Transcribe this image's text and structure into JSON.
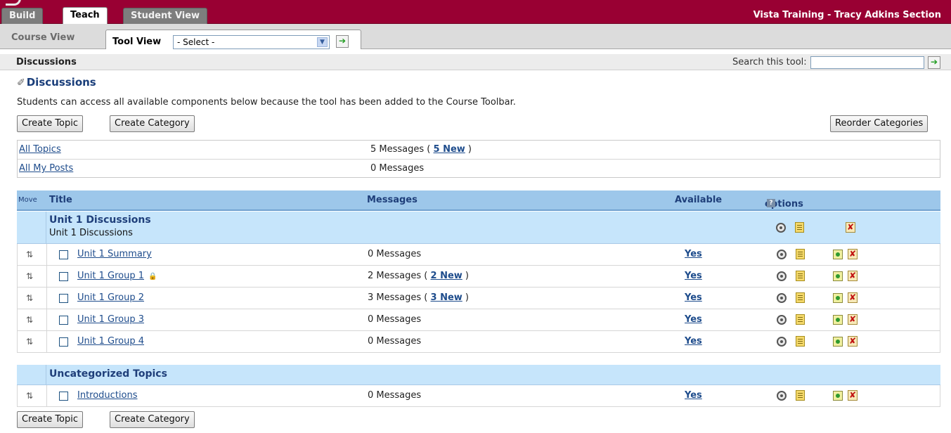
{
  "top_tabs": [
    "Build",
    "Teach",
    "Student View"
  ],
  "course_title": "Vista Training - Tracy Adkins Section",
  "sub_tabs": {
    "course_view": "Course View",
    "tool_view": "Tool View",
    "select_value": "- Select -"
  },
  "title_bar": {
    "title": "Discussions",
    "search_label": "Search this tool:"
  },
  "heading": "Discussions",
  "notice": "Students can access all available components below because the tool has been added to the Course Toolbar.",
  "buttons": {
    "create_topic": "Create Topic",
    "create_category": "Create Category",
    "reorder_categories": "Reorder Categories"
  },
  "summary": [
    {
      "name": "All Topics",
      "count": "5 Messages (",
      "new_label": "5 New",
      "close": ")"
    },
    {
      "name": "All My Posts",
      "count": "0 Messages"
    }
  ],
  "table_header": {
    "move": "Move",
    "title": "Title",
    "messages": "Messages",
    "available": "Available",
    "options": "options",
    "help": "?"
  },
  "categories": [
    {
      "title": "Unit 1 Discussions",
      "subtitle": "Unit 1 Discussions",
      "topics": [
        {
          "name": "Unit 1 Summary",
          "messages": "0 Messages",
          "available": "Yes"
        },
        {
          "name": "Unit 1 Group 1",
          "messages": "2 Messages (",
          "new_label": "2 New",
          "close": ")",
          "available": "Yes",
          "locked": true
        },
        {
          "name": "Unit 1 Group 2",
          "messages": "3 Messages (",
          "new_label": "3 New",
          "close": ")",
          "available": "Yes"
        },
        {
          "name": "Unit 1 Group 3",
          "messages": "0 Messages",
          "available": "Yes"
        },
        {
          "name": "Unit 1 Group 4",
          "messages": "0 Messages",
          "available": "Yes"
        }
      ]
    },
    {
      "title": "Uncategorized Topics",
      "topics": [
        {
          "name": "Introductions",
          "messages": "0 Messages",
          "available": "Yes"
        }
      ]
    }
  ],
  "icons": {
    "go": "go-arrow-icon",
    "pin": "pushpin-icon",
    "move": "move-handle-icon",
    "lock": "lock-icon",
    "settings": "gear-icon",
    "edit": "document-icon",
    "copy": "copy-icon",
    "delete": "delete-icon"
  },
  "colors": {
    "brand": "#990033",
    "header_bg": "#9dc7ea",
    "category_bg": "#c6e5fb",
    "link": "#1e4c8c"
  }
}
